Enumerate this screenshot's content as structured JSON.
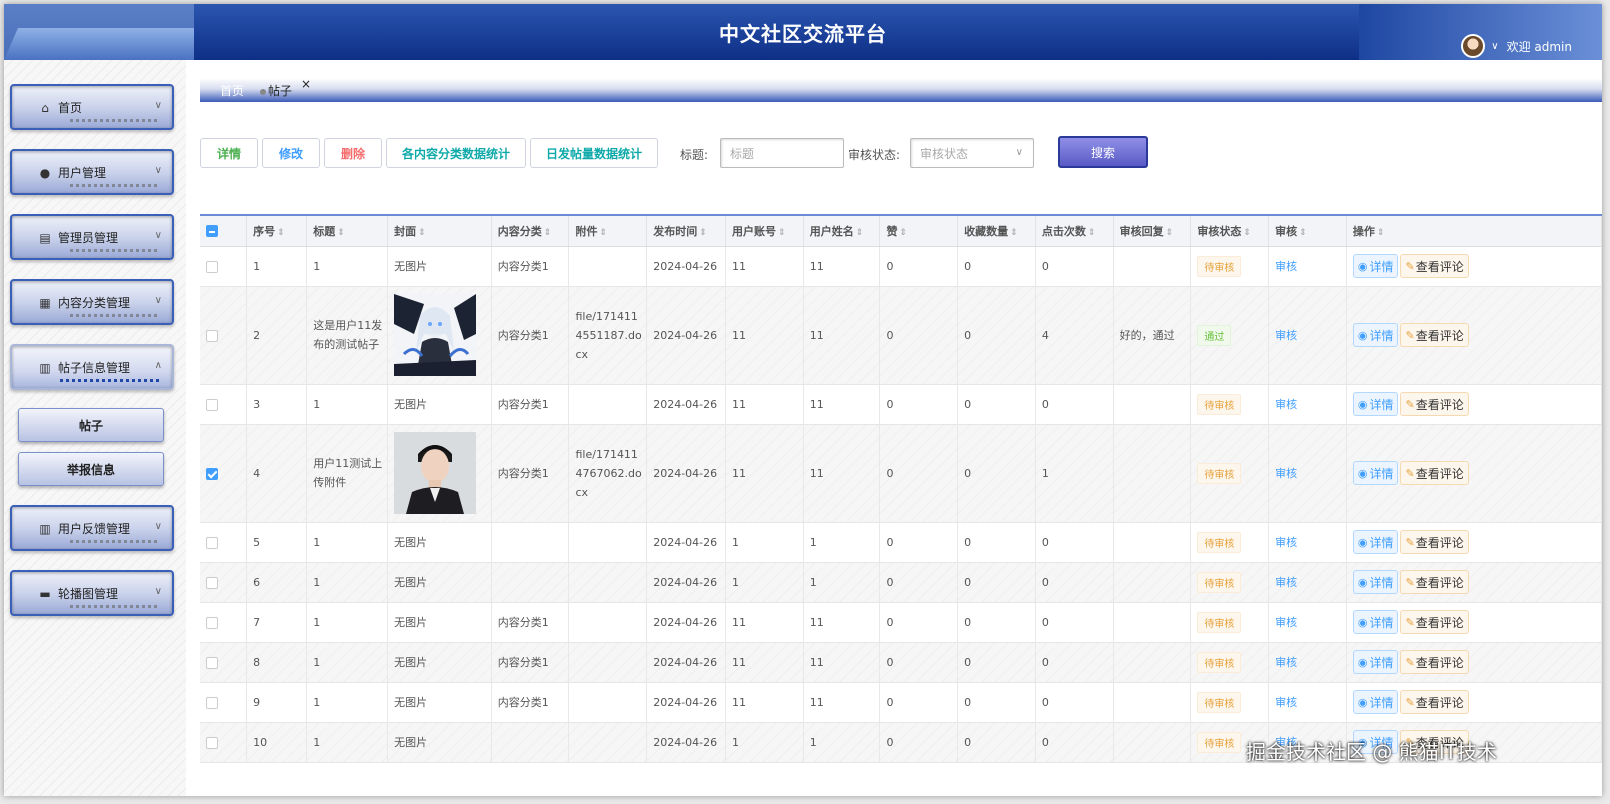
{
  "header": {
    "title": "中文社区交流平台",
    "welcome": "欢迎 admin"
  },
  "sidebar": {
    "items": [
      {
        "label": "首页",
        "icon": "home-icon"
      },
      {
        "label": "用户管理",
        "icon": "user-icon"
      },
      {
        "label": "管理员管理",
        "icon": "admin-icon"
      },
      {
        "label": "内容分类管理",
        "icon": "category-icon"
      },
      {
        "label": "帖子信息管理",
        "icon": "post-icon",
        "active": true
      },
      {
        "label": "用户反馈管理",
        "icon": "feedback-icon"
      },
      {
        "label": "轮播图管理",
        "icon": "carousel-icon"
      }
    ],
    "sub_items": [
      {
        "label": "帖子"
      },
      {
        "label": "举报信息"
      }
    ]
  },
  "tabs": {
    "home": "首页",
    "post": "帖子",
    "close": "×"
  },
  "toolbar": {
    "detail": "详情",
    "edit": "修改",
    "delete": "删除",
    "category_stats": "各内容分类数据统计",
    "daily_stats": "日发帖量数据统计",
    "title_label": "标题:",
    "title_placeholder": "标题",
    "status_label": "审核状态:",
    "status_placeholder": "审核状态",
    "search": "搜索"
  },
  "table": {
    "columns": [
      "序号",
      "标题",
      "封面",
      "内容分类",
      "附件",
      "发布时间",
      "用户账号",
      "用户姓名",
      "赞",
      "收藏数量",
      "点击次数",
      "审核回复",
      "审核状态",
      "审核",
      "操作"
    ],
    "review_link": "审核",
    "op_detail": "详情",
    "op_comment": "查看评论",
    "no_image": "无图片",
    "rows": [
      {
        "no": "1",
        "title": "1",
        "cover": "无图片",
        "category": "内容分类1",
        "attachment": "",
        "date": "2024-04-26",
        "account": "11",
        "name": "11",
        "likes": "0",
        "favorites": "0",
        "clicks": "0",
        "reply": "",
        "status": "待审核",
        "checked": false
      },
      {
        "no": "2",
        "title": "这是用户11发布的测试帖子",
        "cover": "image-anime",
        "category": "内容分类1",
        "attachment": "file/1714114551187.docx",
        "date": "2024-04-26",
        "account": "11",
        "name": "11",
        "likes": "0",
        "favorites": "0",
        "clicks": "4",
        "reply": "好的，通过",
        "status": "通过",
        "checked": false
      },
      {
        "no": "3",
        "title": "1",
        "cover": "无图片",
        "category": "内容分类1",
        "attachment": "",
        "date": "2024-04-26",
        "account": "11",
        "name": "11",
        "likes": "0",
        "favorites": "0",
        "clicks": "0",
        "reply": "",
        "status": "待审核",
        "checked": false
      },
      {
        "no": "4",
        "title": "用户11测试上传附件",
        "cover": "image-portrait",
        "category": "内容分类1",
        "attachment": "file/1714114767062.docx",
        "date": "2024-04-26",
        "account": "11",
        "name": "11",
        "likes": "0",
        "favorites": "0",
        "clicks": "1",
        "reply": "",
        "status": "待审核",
        "checked": true
      },
      {
        "no": "5",
        "title": "1",
        "cover": "无图片",
        "category": "",
        "attachment": "",
        "date": "2024-04-26",
        "account": "1",
        "name": "1",
        "likes": "0",
        "favorites": "0",
        "clicks": "0",
        "reply": "",
        "status": "待审核",
        "checked": false
      },
      {
        "no": "6",
        "title": "1",
        "cover": "无图片",
        "category": "",
        "attachment": "",
        "date": "2024-04-26",
        "account": "1",
        "name": "1",
        "likes": "0",
        "favorites": "0",
        "clicks": "0",
        "reply": "",
        "status": "待审核",
        "checked": false
      },
      {
        "no": "7",
        "title": "1",
        "cover": "无图片",
        "category": "内容分类1",
        "attachment": "",
        "date": "2024-04-26",
        "account": "11",
        "name": "11",
        "likes": "0",
        "favorites": "0",
        "clicks": "0",
        "reply": "",
        "status": "待审核",
        "checked": false
      },
      {
        "no": "8",
        "title": "1",
        "cover": "无图片",
        "category": "内容分类1",
        "attachment": "",
        "date": "2024-04-26",
        "account": "11",
        "name": "11",
        "likes": "0",
        "favorites": "0",
        "clicks": "0",
        "reply": "",
        "status": "待审核",
        "checked": false
      },
      {
        "no": "9",
        "title": "1",
        "cover": "无图片",
        "category": "内容分类1",
        "attachment": "",
        "date": "2024-04-26",
        "account": "11",
        "name": "11",
        "likes": "0",
        "favorites": "0",
        "clicks": "0",
        "reply": "",
        "status": "待审核",
        "checked": false
      },
      {
        "no": "10",
        "title": "1",
        "cover": "无图片",
        "category": "",
        "attachment": "",
        "date": "2024-04-26",
        "account": "1",
        "name": "1",
        "likes": "0",
        "favorites": "0",
        "clicks": "0",
        "reply": "",
        "status": "待审核",
        "checked": false
      }
    ]
  },
  "watermark": "掘金技术社区 @ 熊猫IT技术",
  "colors": {
    "header": "#0e2f86",
    "accent": "#409eff",
    "pending": "#e6a23c",
    "pass": "#67c23a"
  }
}
